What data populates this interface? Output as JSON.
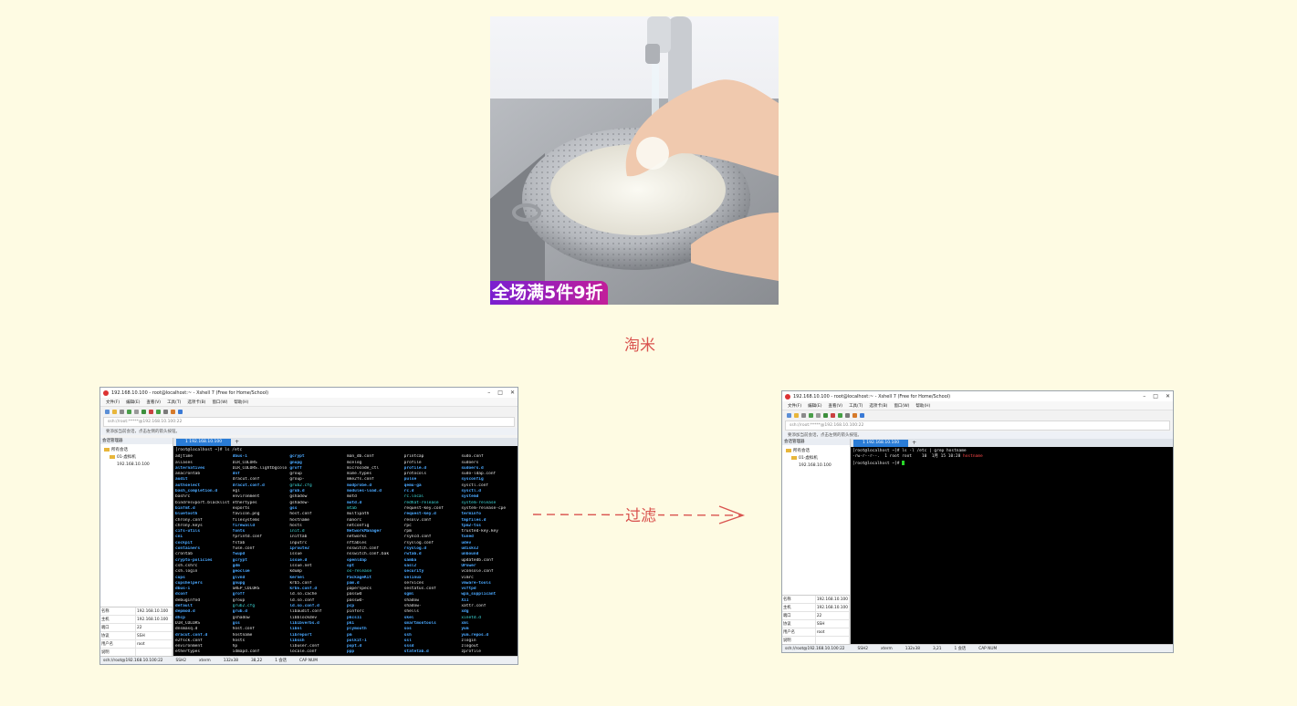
{
  "photo": {
    "promo_text": "全场满5件9折",
    "colors": {
      "promo_start": "#7a1fd0",
      "promo_end": "#c21f9a"
    }
  },
  "captions": {
    "top": "淘米",
    "middle": "过滤"
  },
  "colors": {
    "background": "#fefbe3",
    "accent": "#d9534f",
    "terminal_bg": "#000000"
  },
  "left_window": {
    "title": "192.168.10.100 - root@localhost:~ - Xshell 7 (Free for Home/School)",
    "menu": [
      "文件(F)",
      "编辑(E)",
      "查看(V)",
      "工具(T)",
      "选项卡(B)",
      "窗口(W)",
      "帮助(H)"
    ],
    "address": "ssh://root:*****@192.168.10.100:22",
    "hint": "要添加当前会话，点击左侧的箭头按钮。",
    "sidebar_title": "会话管理器",
    "tree": [
      "所有会话",
      "01-虚拟机",
      "192.168.10.100"
    ],
    "tab_label": "1 192.168.10.100",
    "command": "[root@localhost ~]# ls /etc",
    "props": [
      [
        "名称",
        "192.168.10.100"
      ],
      [
        "主机",
        "192.168.10.100"
      ],
      [
        "端口",
        "22"
      ],
      [
        "协议",
        "SSH"
      ],
      [
        "用户名",
        "root"
      ],
      [
        "说明",
        ""
      ]
    ],
    "status": [
      "ssh://root@192.168.10.100:22",
      "SSH2",
      "xterm",
      "132x38",
      "38,22",
      "1 会话",
      "CAP NUM"
    ],
    "listing": [
      [
        "adjtime",
        "dbus-1",
        "gcrypt",
        "man_db.conf",
        "printcap",
        "sudo.conf"
      ],
      [
        "aliases",
        "DIR_COLORS",
        "gnupg",
        "mcelog",
        "profile",
        "sudoers"
      ],
      [
        "alternatives",
        "DIR_COLORS.lightbgcolor",
        "groff",
        "microcode_ctl",
        "profile.d",
        "sudoers.d"
      ],
      [
        "anacrontab",
        "dnf",
        "group",
        "mime.types",
        "protocols",
        "sudo-ldap.conf"
      ],
      [
        "audit",
        "dracut.conf",
        "group-",
        "mke2fs.conf",
        "pulse",
        "sysconfig"
      ],
      [
        "authselect",
        "dracut.conf.d",
        "grub2.cfg",
        "modprobe.d",
        "qemu-ga",
        "sysctl.conf"
      ],
      [
        "bash_completion.d",
        "egl",
        "grub.d",
        "modules-load.d",
        "rc.d",
        "sysctl.d"
      ],
      [
        "bashrc",
        "environment",
        "gshadow",
        "motd",
        "rc.local",
        "systemd"
      ],
      [
        "bindresvport.blacklist",
        "ethertypes",
        "gshadow-",
        "motd.d",
        "redhat-release",
        "system-release"
      ],
      [
        "binfmt.d",
        "exports",
        "gss",
        "mtab",
        "request-key.conf",
        "system-release-cpe"
      ],
      [
        "bluetooth",
        "favicon.png",
        "host.conf",
        "multipath",
        "request-key.d",
        "terminfo"
      ],
      [
        "chrony.conf",
        "filesystems",
        "hostname",
        "nanorc",
        "resolv.conf",
        "tmpfiles.d"
      ],
      [
        "chrony.keys",
        "firewalld",
        "hosts",
        "netconfig",
        "rpc",
        "tpm2-tss"
      ],
      [
        "cifs-utils",
        "fonts",
        "init.d",
        "NetworkManager",
        "rpm",
        "trusted-key.key"
      ],
      [
        "cni",
        "fprintd.conf",
        "inittab",
        "networks",
        "rsyncd.conf",
        "tuned"
      ],
      [
        "cockpit",
        "fstab",
        "inputrc",
        "nftables",
        "rsyslog.conf",
        "udev"
      ],
      [
        "containers",
        "fuse.conf",
        "iproute2",
        "nsswitch.conf",
        "rsyslog.d",
        "udisks2"
      ],
      [
        "crontab",
        "fwupd",
        "issue",
        "nsswitch.conf.bak",
        "rwtab.d",
        "unbound"
      ],
      [
        "crypto-policies",
        "gcrypt",
        "issue.d",
        "openldap",
        "samba",
        "updatedb.conf"
      ],
      [
        "csh.cshrc",
        "gdm",
        "issue.net",
        "opt",
        "sasl2",
        "UPower"
      ],
      [
        "csh.login",
        "geoclue",
        "kdump",
        "os-release",
        "security",
        "vconsole.conf"
      ],
      [
        "cups",
        "glvnd",
        "kernel",
        "PackageKit",
        "selinux",
        "vimrc"
      ],
      [
        "cupshelpers",
        "gnupg",
        "krb5.conf",
        "pam.d",
        "services",
        "vmware-tools"
      ],
      [
        "dbus-1",
        "GREP_COLORS",
        "krb5.conf.d",
        "paperspecs",
        "sestatus.conf",
        "vsftpd"
      ],
      [
        "dconf",
        "groff",
        "ld.so.cache",
        "passwd",
        "sgml",
        "wpa_supplicant"
      ],
      [
        "debuginfod",
        "group",
        "ld.so.conf",
        "passwd-",
        "shadow",
        "X11"
      ],
      [
        "default",
        "grub2.cfg",
        "ld.so.conf.d",
        "pcp",
        "shadow-",
        "xattr.conf"
      ],
      [
        "depmod.d",
        "grub.d",
        "libaudit.conf",
        "pinforc",
        "shells",
        "xdg"
      ],
      [
        "dhcp",
        "gshadow",
        "libblockdev",
        "pkcs11",
        "skel",
        "xinetd.d"
      ],
      [
        "DIR_COLORS",
        "gss",
        "libibverbs.d",
        "pki",
        "smartmontools",
        "xml"
      ],
      [
        "dnsmasq.d",
        "host.conf",
        "libnl",
        "plymouth",
        "sos",
        "yum"
      ],
      [
        "dracut.conf.d",
        "hostname",
        "libreport",
        "pm",
        "ssh",
        "yum.repos.d"
      ],
      [
        "e2fsck.conf",
        "hosts",
        "libssh",
        "polkit-1",
        "ssl",
        "zlogin"
      ],
      [
        "environment",
        "hp",
        "libuser.conf",
        "popt.d",
        "sssd",
        "zlogout"
      ],
      [
        "ethertypes",
        "idmapd.conf",
        "locale.conf",
        "ppp",
        "statetab.d",
        "zprofile"
      ]
    ]
  },
  "right_window": {
    "title": "192.168.10.100 - root@localhost:~ - Xshell 7 (Free for Home/School)",
    "menu": [
      "文件(F)",
      "编辑(E)",
      "查看(V)",
      "工具(T)",
      "选项卡(B)",
      "窗口(W)",
      "帮助(H)"
    ],
    "address": "ssh://root:*****@192.168.10.100:22",
    "hint": "要添加当前会话，点击左侧的箭头按钮。",
    "sidebar_title": "会话管理器",
    "tree": [
      "所有会话",
      "01-虚拟机",
      "192.168.10.100"
    ],
    "tab_label": "1 192.168.10.100",
    "line1": "[root@localhost ~]# ls -l /etc | grep hostname",
    "line2_prefix": "-rw-r--r--.  1 root root    10  1月 15 10:28 ",
    "line2_highlight": "hostname",
    "line3": "[root@localhost ~]# ",
    "props": [
      [
        "名称",
        "192.168.10.100"
      ],
      [
        "主机",
        "192.168.10.100"
      ],
      [
        "端口",
        "22"
      ],
      [
        "协议",
        "SSH"
      ],
      [
        "用户名",
        "root"
      ],
      [
        "说明",
        ""
      ]
    ],
    "status": [
      "ssh://root@192.168.10.100:22",
      "SSH2",
      "xterm",
      "132x38",
      "3,21",
      "1 会话",
      "CAP NUM"
    ]
  }
}
